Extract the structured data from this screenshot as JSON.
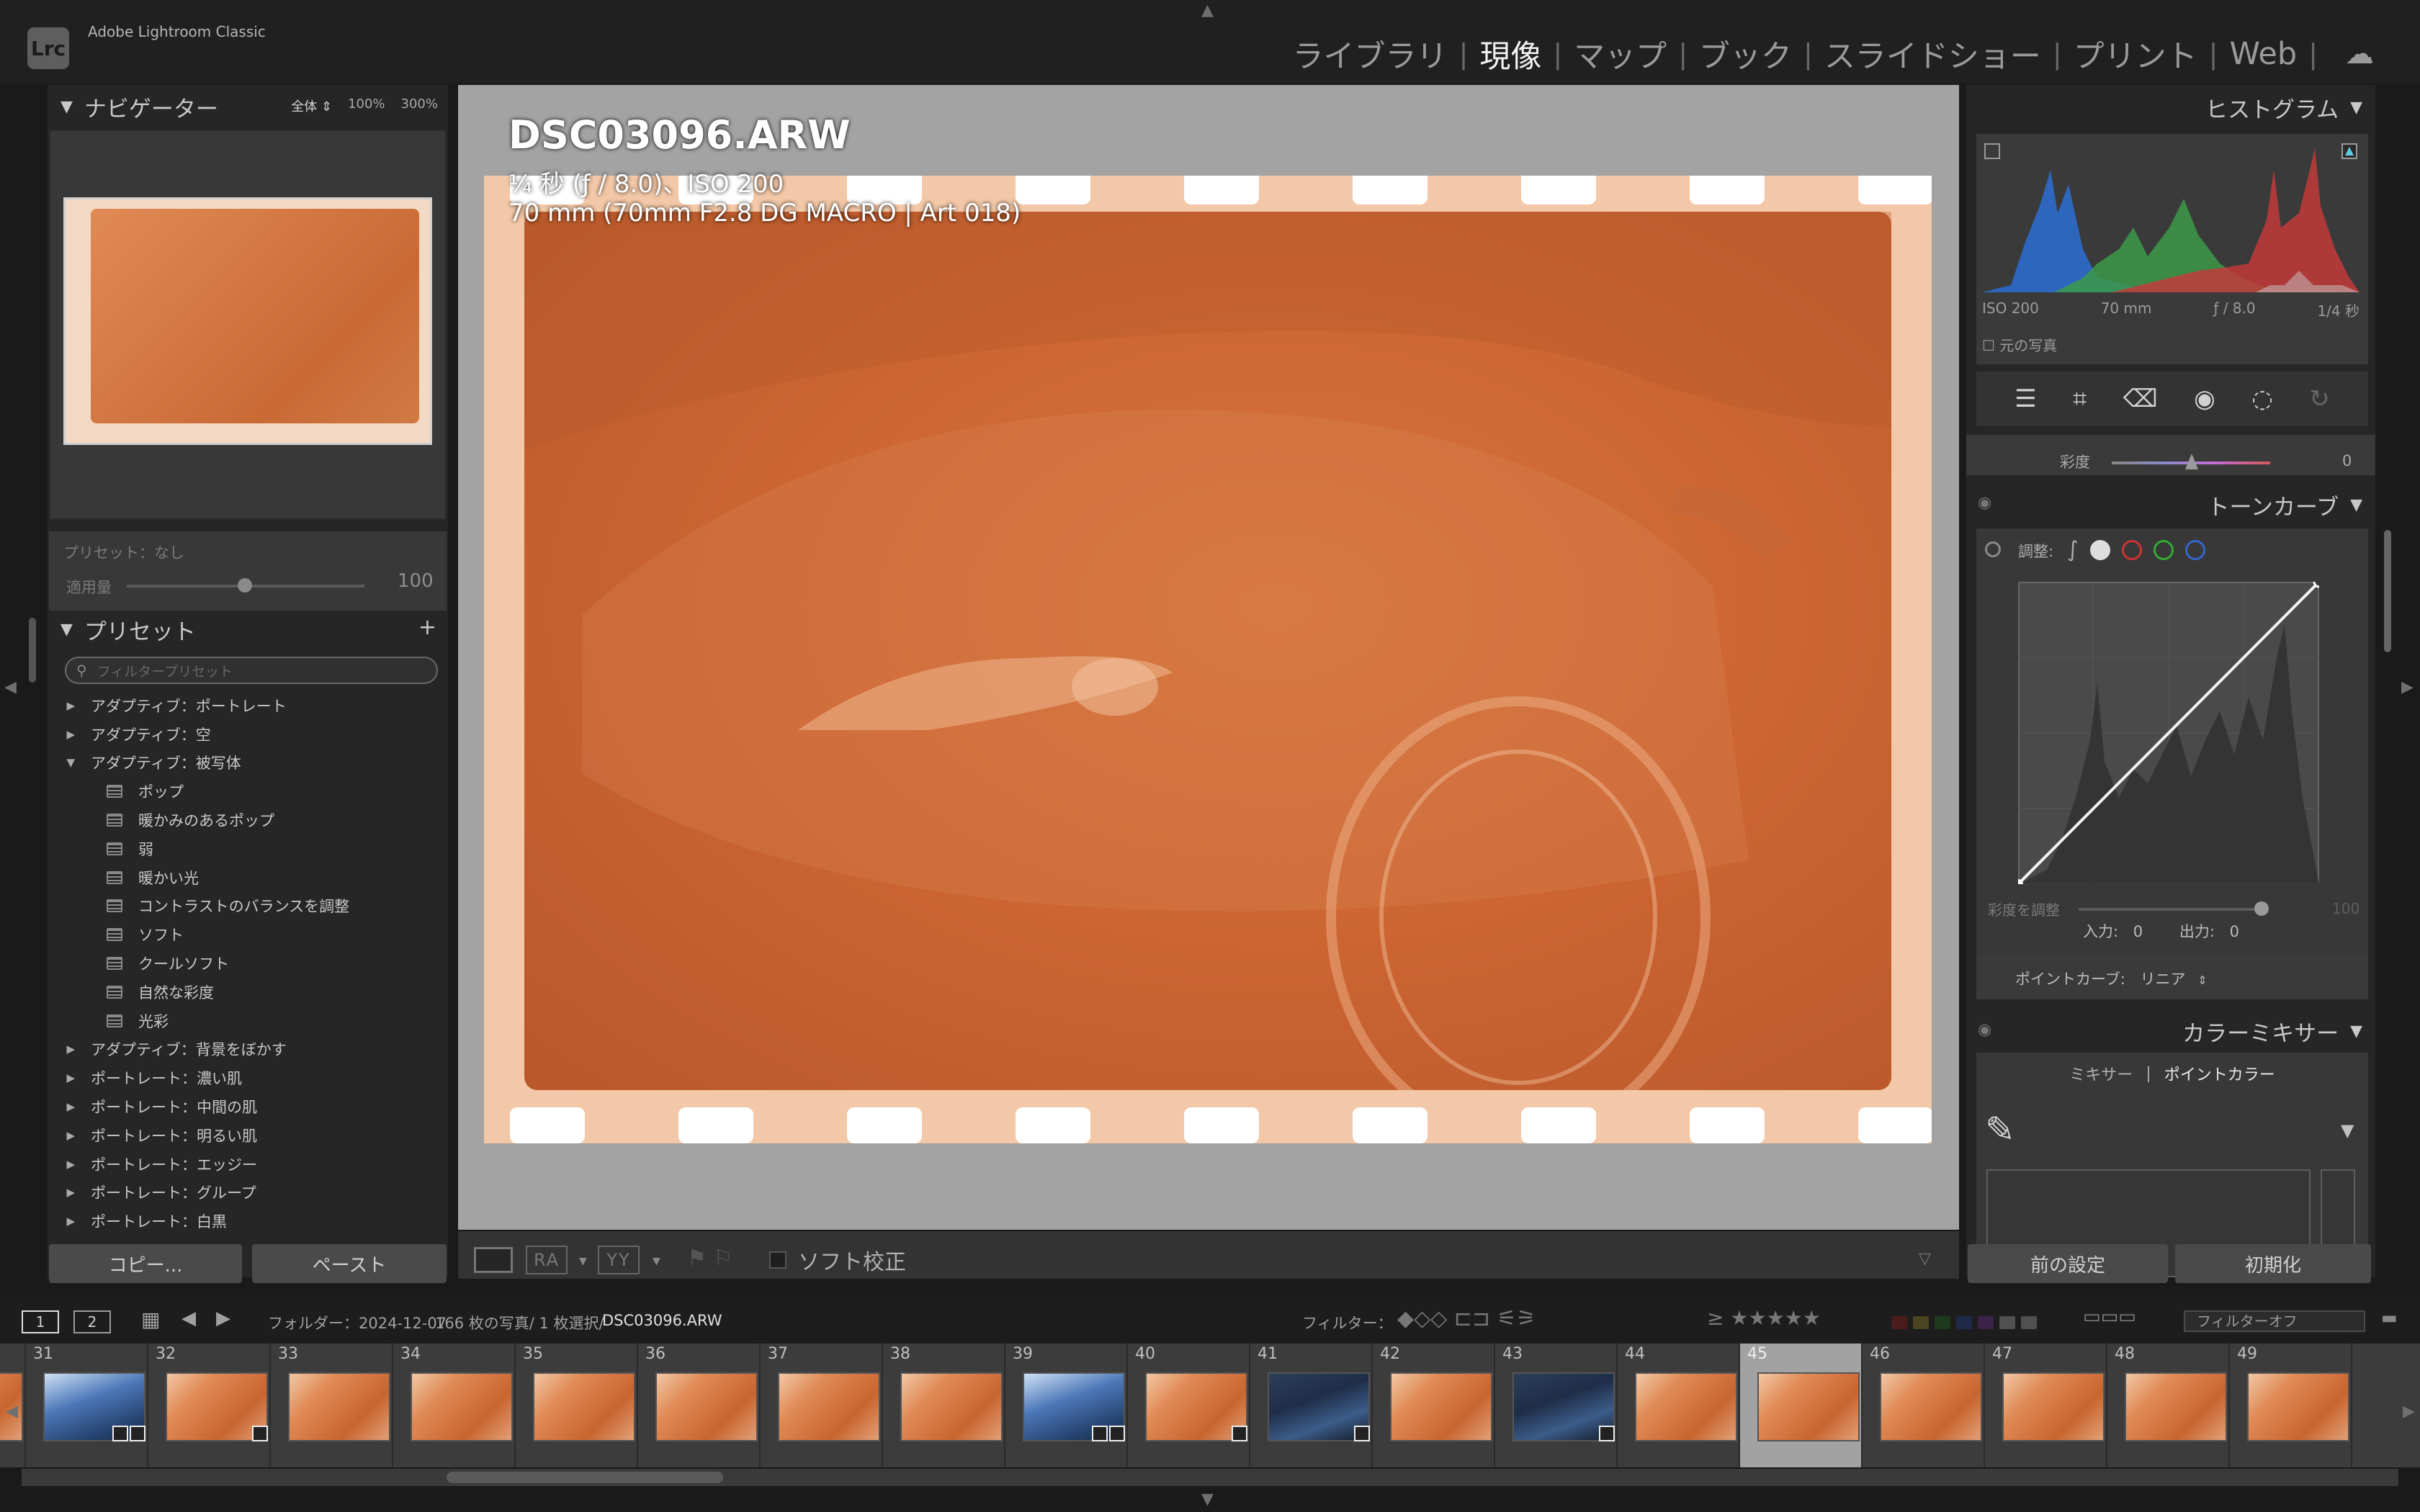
{
  "app": {
    "logo": "Lrc",
    "name": "Adobe Lightroom Classic"
  },
  "modules": [
    "ライブラリ",
    "現像",
    "マップ",
    "ブック",
    "スライドショー",
    "プリント",
    "Web"
  ],
  "active_module": "現像",
  "left_panel": {
    "navigator_title": "ナビゲーター",
    "zoom_options": [
      "全体",
      "100%",
      "300%"
    ],
    "preset_label": "プリセット：なし",
    "amount_label": "適用量",
    "amount_value": "100",
    "presets_title": "プリセット",
    "search_placeholder": "フィルタープリセット",
    "presets": [
      {
        "label": "アダプティブ：ポートレート",
        "type": "group",
        "expanded": false
      },
      {
        "label": "アダプティブ：空",
        "type": "group",
        "expanded": false
      },
      {
        "label": "アダプティブ：被写体",
        "type": "group",
        "expanded": true
      },
      {
        "label": "ポップ",
        "type": "item"
      },
      {
        "label": "暖かみのあるポップ",
        "type": "item"
      },
      {
        "label": "弱",
        "type": "item"
      },
      {
        "label": "暖かい光",
        "type": "item"
      },
      {
        "label": "コントラストのバランスを調整",
        "type": "item"
      },
      {
        "label": "ソフト",
        "type": "item"
      },
      {
        "label": "クールソフト",
        "type": "item"
      },
      {
        "label": "自然な彩度",
        "type": "item"
      },
      {
        "label": "光彩",
        "type": "item"
      },
      {
        "label": "アダプティブ：背景をぼかす",
        "type": "group",
        "expanded": false
      },
      {
        "label": "ポートレート：濃い肌",
        "type": "group",
        "expanded": false
      },
      {
        "label": "ポートレート：中間の肌",
        "type": "group",
        "expanded": false
      },
      {
        "label": "ポートレート：明るい肌",
        "type": "group",
        "expanded": false
      },
      {
        "label": "ポートレート：エッジー",
        "type": "group",
        "expanded": false
      },
      {
        "label": "ポートレート：グループ",
        "type": "group",
        "expanded": false
      },
      {
        "label": "ポートレート：白黒",
        "type": "group",
        "expanded": false
      }
    ],
    "copy_button": "コピー...",
    "paste_button": "ペースト"
  },
  "image": {
    "filename": "DSC03096.ARW",
    "exposure": "¼ 秒 (ƒ / 8.0)、ISO 200",
    "lens": "70 mm (70mm F2.8 DG MACRO | Art 018)"
  },
  "toolbar": {
    "compare1": "RA",
    "compare2": "YY",
    "soft_proof_label": "ソフト校正",
    "soft_proof_checked": false
  },
  "right_panel": {
    "histogram_title": "ヒストグラム",
    "hist_info": [
      "ISO 200",
      "70 mm",
      "ƒ / 8.0",
      "1/4 秒"
    ],
    "original_photo": "元の写真",
    "saturation_label": "彩度",
    "saturation_value": "0",
    "tone_curve_title": "トーンカーブ",
    "adjust_label": "調整:",
    "sat_adjust_label": "彩度を調整",
    "sat_adjust_value": "100",
    "input_label": "入力:",
    "input_value": "0",
    "output_label": "出力:",
    "output_value": "0",
    "point_curve_label": "ポイントカーブ:",
    "point_curve_value": "リニア",
    "color_mixer_title": "カラーミキサー",
    "mixer_tabs": [
      "ミキサー",
      "ポイントカラー"
    ],
    "active_mixer_tab": "ポイントカラー",
    "prev_button": "前の設定",
    "reset_button": "初期化"
  },
  "filmstrip_bar": {
    "screen1": "1",
    "screen2": "2",
    "folder_text": "フォルダー：2024-12-07",
    "count_text": "166 枚の写真/ 1 枚選択/",
    "selected_file": "DSC03096.ARW",
    "filter_label": "フィルター：",
    "filter_value": "フィルターオフ",
    "swatch_colors": [
      "#4a1c1c",
      "#4a4420",
      "#1e3a1e",
      "#1e2a48",
      "#3a2248",
      "#505050",
      "#505050"
    ]
  },
  "filmstrip": [
    {
      "num": "",
      "kind": "orange",
      "badge": 0
    },
    {
      "num": "31",
      "kind": "blue",
      "badge": 2
    },
    {
      "num": "32",
      "kind": "orange",
      "badge": 1
    },
    {
      "num": "33",
      "kind": "orange",
      "badge": 0
    },
    {
      "num": "34",
      "kind": "orange",
      "badge": 0
    },
    {
      "num": "35",
      "kind": "orange",
      "badge": 0
    },
    {
      "num": "36",
      "kind": "orange",
      "badge": 0
    },
    {
      "num": "37",
      "kind": "orange",
      "badge": 0
    },
    {
      "num": "38",
      "kind": "orange",
      "badge": 0
    },
    {
      "num": "39",
      "kind": "blue",
      "badge": 2
    },
    {
      "num": "40",
      "kind": "orange",
      "badge": 1
    },
    {
      "num": "41",
      "kind": "dark",
      "badge": 1
    },
    {
      "num": "42",
      "kind": "orange",
      "badge": 0
    },
    {
      "num": "43",
      "kind": "dark",
      "badge": 1
    },
    {
      "num": "44",
      "kind": "orange",
      "badge": 0
    },
    {
      "num": "45",
      "kind": "orange",
      "badge": 0,
      "selected": true
    },
    {
      "num": "46",
      "kind": "orange",
      "badge": 0
    },
    {
      "num": "47",
      "kind": "orange",
      "badge": 0
    },
    {
      "num": "48",
      "kind": "orange",
      "badge": 0
    },
    {
      "num": "49",
      "kind": "orange",
      "badge": 0
    }
  ]
}
